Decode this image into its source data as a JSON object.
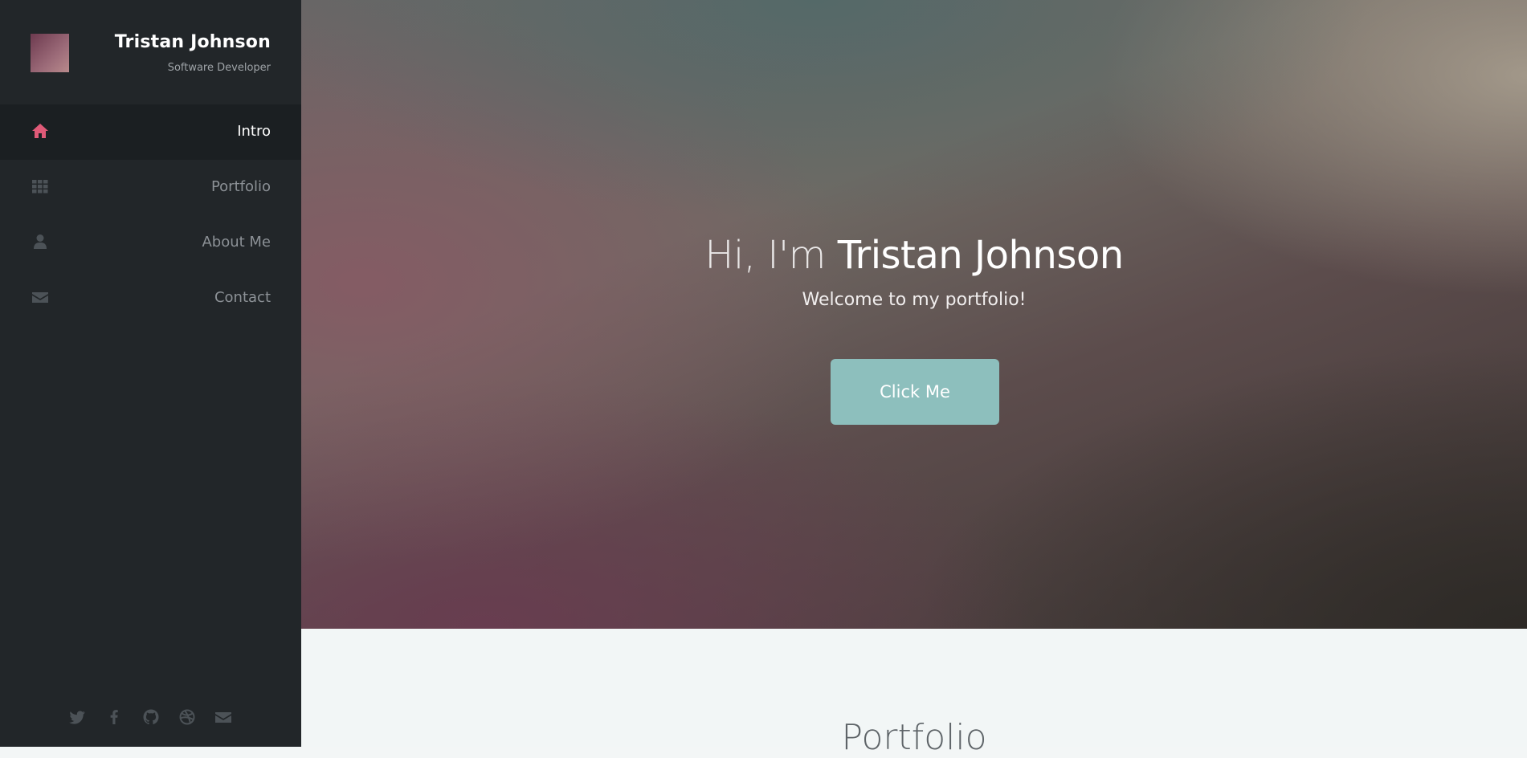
{
  "sidebar": {
    "profile": {
      "name": "Tristan Johnson",
      "role": "Software Developer"
    },
    "nav": [
      {
        "label": "Intro",
        "icon": "home-icon",
        "active": true
      },
      {
        "label": "Portfolio",
        "icon": "grid-icon",
        "active": false
      },
      {
        "label": "About Me",
        "icon": "user-icon",
        "active": false
      },
      {
        "label": "Contact",
        "icon": "envelope-icon",
        "active": false
      }
    ],
    "socials": [
      "twitter-icon",
      "facebook-icon",
      "github-icon",
      "dribbble-icon",
      "envelope-icon"
    ]
  },
  "hero": {
    "title_prefix": "Hi, I'm ",
    "title_name": "Tristan Johnson",
    "subtitle": "Welcome to my portfolio!",
    "button_label": "Click Me"
  },
  "portfolio": {
    "title": "Portfolio"
  },
  "colors": {
    "sidebar_bg": "#222629",
    "active_nav_bg": "#1b1f22",
    "accent_icon": "#e05a78",
    "button": "#8dbfbd",
    "icon_muted": "#4c5257"
  }
}
